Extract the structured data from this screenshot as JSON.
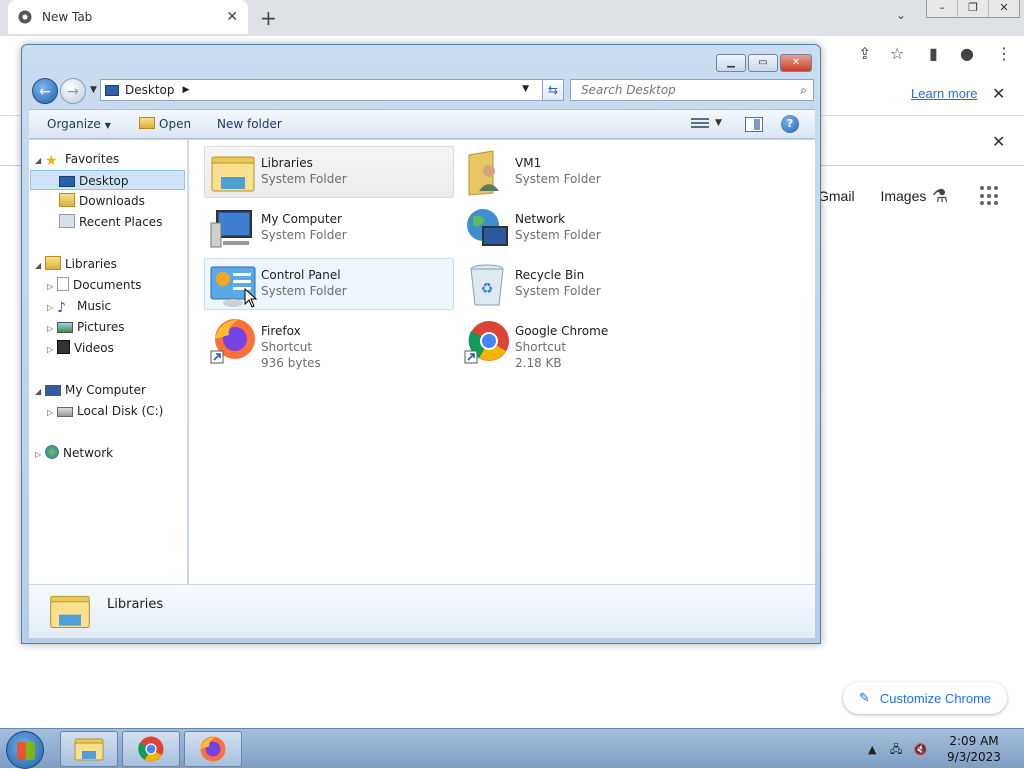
{
  "browser": {
    "tab_title": "New Tab",
    "tab_close": "✕",
    "new_tab": "+",
    "learn_more": "Learn more",
    "info_close": "✕",
    "links": [
      "Gmail",
      "Images"
    ],
    "customize": "Customize Chrome"
  },
  "explorer": {
    "address": "Desktop",
    "search_placeholder": "Search Desktop",
    "toolbar": {
      "organize": "Organize",
      "open": "Open",
      "new_folder": "New folder"
    },
    "nav": {
      "favorites": "Favorites",
      "desktop": "Desktop",
      "downloads": "Downloads",
      "recent_places": "Recent Places",
      "libraries": "Libraries",
      "documents": "Documents",
      "music": "Music",
      "pictures": "Pictures",
      "videos": "Videos",
      "my_computer": "My Computer",
      "local_disk": "Local Disk (C:)",
      "network": "Network"
    },
    "items": [
      {
        "name": "Libraries",
        "type": "System Folder",
        "icon": "libraries-folder-icon"
      },
      {
        "name": "VM1",
        "type": "System Folder",
        "icon": "user-folder-icon"
      },
      {
        "name": "My Computer",
        "type": "System Folder",
        "icon": "computer-icon"
      },
      {
        "name": "Network",
        "type": "System Folder",
        "icon": "network-icon"
      },
      {
        "name": "Control Panel",
        "type": "System Folder",
        "icon": "control-panel-icon"
      },
      {
        "name": "Recycle Bin",
        "type": "System Folder",
        "icon": "recycle-bin-icon"
      },
      {
        "name": "Firefox",
        "type": "Shortcut",
        "size": "936 bytes",
        "icon": "firefox-icon"
      },
      {
        "name": "Google Chrome",
        "type": "Shortcut",
        "size": "2.18 KB",
        "icon": "chrome-icon"
      }
    ],
    "details_name": "Libraries"
  },
  "taskbar": {
    "time": "2:09 AM",
    "date": "9/3/2023"
  },
  "colors": {
    "chrome_blue": "#1a73e8",
    "selection": "#cfe3fb",
    "taskbar": "#8fabcf"
  }
}
